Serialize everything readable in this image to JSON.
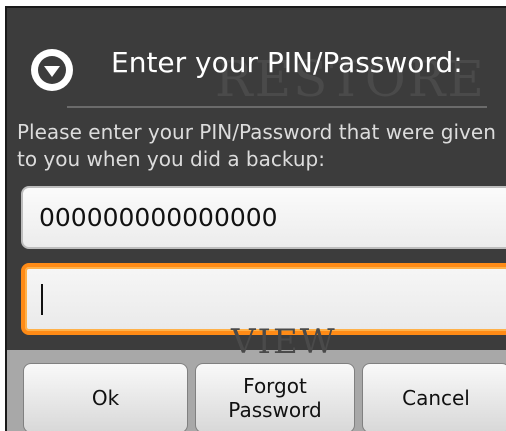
{
  "dialog": {
    "title": "Enter your PIN/Password:",
    "title_icon": "circle-chevron-down-icon",
    "message": "Please enter your PIN/Password that were given to you when you did a backup:"
  },
  "background_watermark": {
    "top_text": "RESTORE",
    "bottom_text": "VIEW"
  },
  "fields": {
    "pin_value": "000000000000000",
    "password_value": ""
  },
  "buttons": {
    "ok_label": "Ok",
    "forgot_label_line1": "Forgot",
    "forgot_label_line2": "Password",
    "cancel_label": "Cancel"
  },
  "colors": {
    "dialog_background": "#3c3c3c",
    "focus_border": "#ff8b16",
    "button_bar": "#a8a8a8"
  }
}
